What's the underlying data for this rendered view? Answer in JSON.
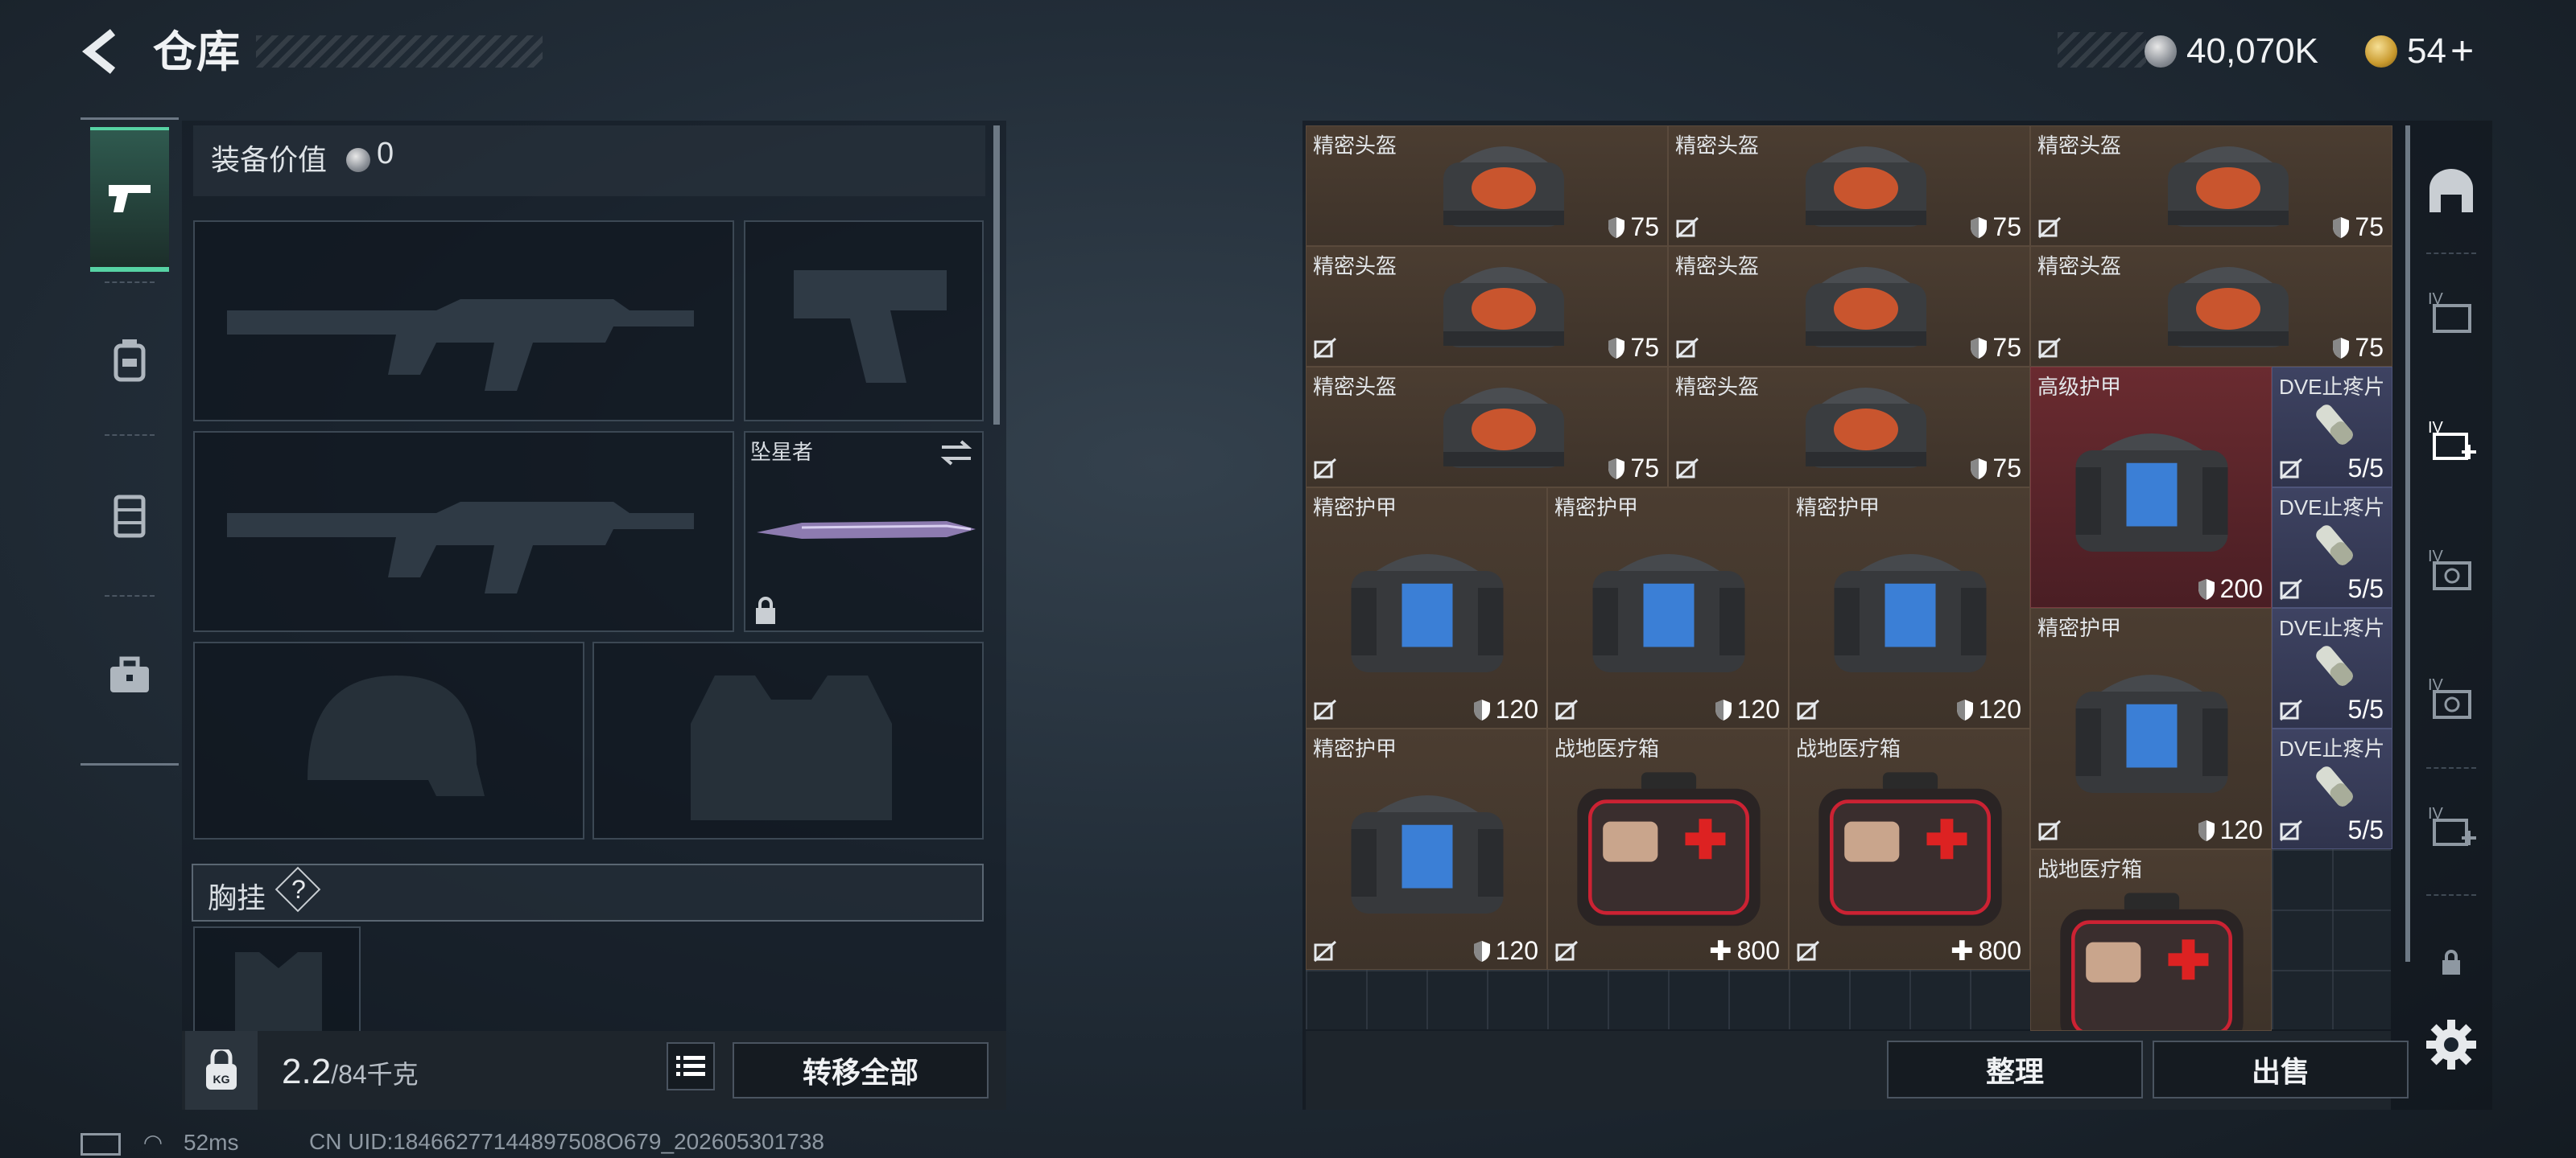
{
  "header": {
    "title": "仓库",
    "currency_silver": "40,070K",
    "currency_gold": "54"
  },
  "left": {
    "equipment_value_label": "装备价值",
    "equipment_value": "0",
    "melee_name": "坠星者",
    "chest_rig_label": "胸挂",
    "help_glyph": "?",
    "weight_value": "2.2",
    "weight_max": "/84千克",
    "transfer_all": "转移全部",
    "kg_icon_text": "KG"
  },
  "status": {
    "ping": "52ms",
    "uid": "CN UID:18466277144897508O679_202605301738"
  },
  "inventory": {
    "items": [
      {
        "name": "精密头盔",
        "value": "75",
        "kind": "helmet",
        "shield": true,
        "nobind": false
      },
      {
        "name": "精密头盔",
        "value": "75",
        "kind": "helmet",
        "shield": true,
        "nobind": true
      },
      {
        "name": "精密头盔",
        "value": "75",
        "kind": "helmet",
        "shield": true,
        "nobind": true
      },
      {
        "name": "精密头盔",
        "value": "75",
        "kind": "helmet",
        "shield": true,
        "nobind": true
      },
      {
        "name": "精密头盔",
        "value": "75",
        "kind": "helmet",
        "shield": true,
        "nobind": true
      },
      {
        "name": "精密头盔",
        "value": "75",
        "kind": "helmet",
        "shield": true,
        "nobind": true
      },
      {
        "name": "精密头盔",
        "value": "75",
        "kind": "helmet",
        "shield": true,
        "nobind": true
      },
      {
        "name": "精密头盔",
        "value": "75",
        "kind": "helmet",
        "shield": true,
        "nobind": true
      },
      {
        "name": "高级护甲",
        "value": "200",
        "kind": "armor",
        "shield": true,
        "nobind": false
      },
      {
        "name": "DVE止疼片",
        "value": "5/5",
        "kind": "pill",
        "shield": false,
        "nobind": true
      },
      {
        "name": "DVE止疼片",
        "value": "5/5",
        "kind": "pill",
        "shield": false,
        "nobind": true
      },
      {
        "name": "DVE止疼片",
        "value": "5/5",
        "kind": "pill",
        "shield": false,
        "nobind": true
      },
      {
        "name": "DVE止疼片",
        "value": "5/5",
        "kind": "pill",
        "shield": false,
        "nobind": true
      },
      {
        "name": "精密护甲",
        "value": "120",
        "kind": "armor",
        "shield": true,
        "nobind": true
      },
      {
        "name": "精密护甲",
        "value": "120",
        "kind": "armor",
        "shield": true,
        "nobind": true
      },
      {
        "name": "精密护甲",
        "value": "120",
        "kind": "armor",
        "shield": true,
        "nobind": true
      },
      {
        "name": "精密护甲",
        "value": "120",
        "kind": "armor",
        "shield": true,
        "nobind": true
      },
      {
        "name": "精密护甲",
        "value": "120",
        "kind": "armor",
        "shield": true,
        "nobind": true
      },
      {
        "name": "战地医疗箱",
        "value": "800",
        "kind": "medkit",
        "shield": false,
        "nobind": true
      },
      {
        "name": "战地医疗箱",
        "value": "800",
        "kind": "medkit",
        "shield": false,
        "nobind": true
      },
      {
        "name": "战地医疗箱",
        "value": "",
        "kind": "medkit",
        "shield": false,
        "nobind": false
      }
    ]
  },
  "actions": {
    "sort": "整理",
    "sell": "出售"
  },
  "colors": {
    "accent": "#57d3a4",
    "cell_brown": "#4b3d31",
    "cell_red": "#6a2b30",
    "cell_purple": "#3e4362"
  }
}
